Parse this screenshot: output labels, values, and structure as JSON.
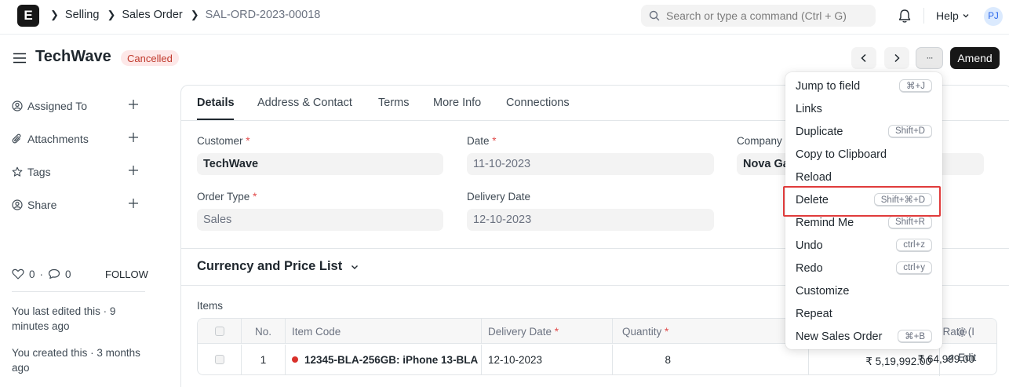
{
  "navbar": {
    "logo": "E",
    "breadcrumbs": [
      "Selling",
      "Sales Order",
      "SAL-ORD-2023-00018"
    ],
    "search_placeholder": "Search or type a command (Ctrl + G)",
    "help_label": "Help",
    "avatar_initials": "PJ",
    "icons": [
      "logo-icon",
      "bell-icon",
      "search-icon",
      "chevron-down-icon"
    ]
  },
  "header": {
    "title": "TechWave",
    "status": "Cancelled",
    "amend_label": "Amend",
    "more_label": "···"
  },
  "sidebar": {
    "items": [
      {
        "label": "Assigned To",
        "icon": "assign-icon"
      },
      {
        "label": "Attachments",
        "icon": "paperclip-icon"
      },
      {
        "label": "Tags",
        "icon": "star-icon"
      },
      {
        "label": "Share",
        "icon": "share-icon"
      }
    ],
    "likes": "0",
    "comments": "0",
    "follow_label": "FOLLOW",
    "last_edited": "You last edited this · 9 minutes ago",
    "created": "You created this · 3 months ago"
  },
  "tabs": [
    "Details",
    "Address & Contact",
    "Terms",
    "More Info",
    "Connections"
  ],
  "form": {
    "customer_label": "Customer",
    "customer_value": "TechWave",
    "date_label": "Date",
    "date_value": "11-10-2023",
    "company_label": "Company",
    "company_value": "Nova Ga",
    "order_type_label": "Order Type",
    "order_type_value": "Sales",
    "delivery_date_label": "Delivery Date",
    "delivery_date_value": "12-10-2023",
    "required_mark": "*"
  },
  "section": {
    "title": "Currency and Price List",
    "items_label": "Items"
  },
  "items_table": {
    "headers": {
      "no": "No.",
      "item_code": "Item Code",
      "delivery_date": "Delivery Date",
      "quantity": "Quantity",
      "rate": "Rate (I"
    },
    "rows": [
      {
        "no": "1",
        "item_code": "12345-BLA-256GB: iPhone 13-BLA",
        "delivery_date": "12-10-2023",
        "quantity": "8",
        "rate": "₹ 64,999.00",
        "amount": "₹ 5,19,992.00",
        "edit": "Edit"
      }
    ]
  },
  "menu": {
    "items": [
      {
        "label": "Jump to field",
        "shortcut": "⌘+J"
      },
      {
        "label": "Links",
        "shortcut": ""
      },
      {
        "label": "Duplicate",
        "shortcut": "Shift+D"
      },
      {
        "label": "Copy to Clipboard",
        "shortcut": ""
      },
      {
        "label": "Reload",
        "shortcut": ""
      },
      {
        "label": "Delete",
        "shortcut": "Shift+⌘+D"
      },
      {
        "label": "Remind Me",
        "shortcut": "Shift+R"
      },
      {
        "label": "Undo",
        "shortcut": "ctrl+z"
      },
      {
        "label": "Redo",
        "shortcut": "ctrl+y"
      },
      {
        "label": "Customize",
        "shortcut": ""
      },
      {
        "label": "Repeat",
        "shortcut": ""
      },
      {
        "label": "New Sales Order",
        "shortcut": "⌘+B"
      }
    ],
    "highlighted": "Delete",
    "highlight_color": "#e03b3b"
  }
}
